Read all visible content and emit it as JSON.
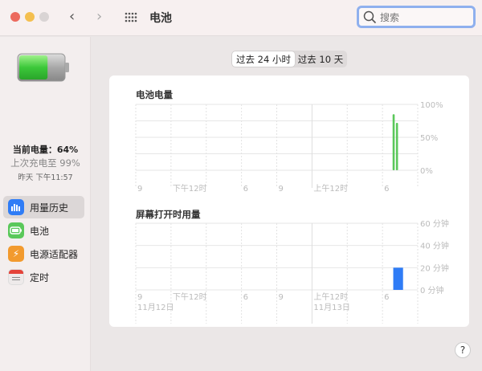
{
  "window": {
    "title": "电池",
    "search_placeholder": "搜索",
    "colors": {
      "close": "#ec6a5e",
      "minimize": "#f4bf4f",
      "zoom": "#d9d4d4"
    }
  },
  "sidebar": {
    "current_charge": "当前电量：64%",
    "last_charged": "上次充电至 99%",
    "last_charged_time": "昨天 下午11:57",
    "battery_level": 64,
    "items": [
      {
        "label": "用量历史",
        "icon": "bar-chart-icon",
        "color": "#2f7cf6",
        "active": true
      },
      {
        "label": "电池",
        "icon": "battery-icon",
        "color": "#5ac85a",
        "active": false
      },
      {
        "label": "电源适配器",
        "icon": "lightning-icon",
        "color": "#f29a2e",
        "active": false
      },
      {
        "label": "定时",
        "icon": "calendar-icon",
        "color": "#e6e2e2",
        "active": false
      }
    ]
  },
  "segmented": {
    "options": [
      "过去 24 小时",
      "过去 10 天"
    ],
    "selected": 0
  },
  "help_label": "?",
  "chart_data": [
    {
      "type": "bar",
      "title": "电池电量",
      "color": "#5ac85a",
      "x_ticks": [
        "9",
        "下午12时",
        "",
        "6",
        "9",
        "上午12时",
        "",
        "6",
        ""
      ],
      "y_ticks": [
        "0%",
        "50%",
        "100%"
      ],
      "ylim": [
        0,
        100
      ],
      "grid": true,
      "bars": [
        {
          "x": "11-13 06:57",
          "value": 85
        },
        {
          "x": "11-13 07:14",
          "value": 72
        }
      ]
    },
    {
      "type": "bar",
      "title": "屏幕打开时用量",
      "color": "#2f7cf6",
      "x_ticks": [
        "9",
        "下午12时",
        "",
        "6",
        "9",
        "上午12时",
        "",
        "6",
        ""
      ],
      "date_labels": [
        {
          "at": "9",
          "text": "11月12日"
        },
        {
          "at": "上午12时",
          "text": "11月13日"
        }
      ],
      "y_ticks": [
        "0 分钟",
        "20 分钟",
        "40 分钟",
        "60 分钟"
      ],
      "ylim": [
        0,
        60
      ],
      "grid": true,
      "bars": [
        {
          "start": "11-13 06:55",
          "end": "11-13 07:45",
          "value": 20
        }
      ]
    }
  ]
}
